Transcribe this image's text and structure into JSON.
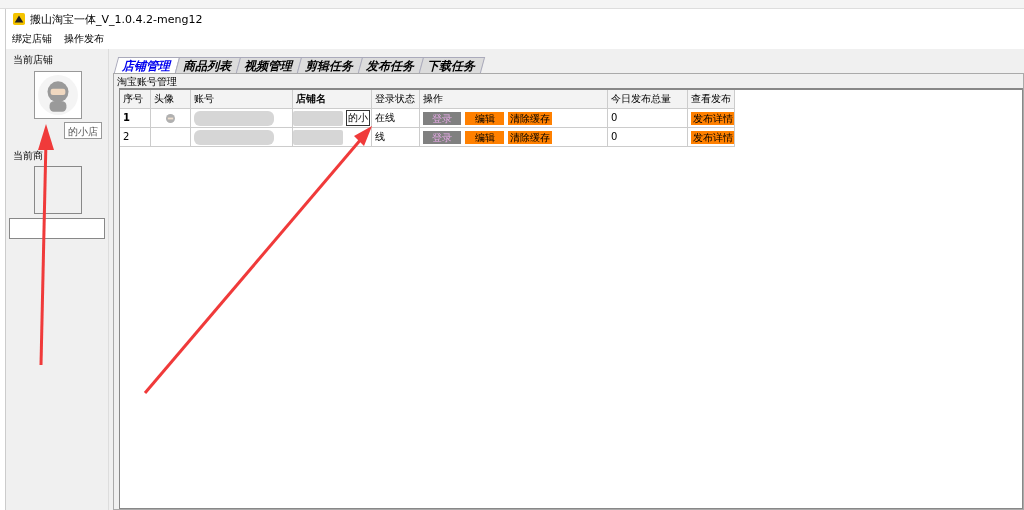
{
  "window": {
    "title": "搬山淘宝一体_V_1.0.4.2-meng12"
  },
  "menu": [
    "绑定店铺",
    "操作发布"
  ],
  "sidebar": {
    "store_label": "当前店铺",
    "store_name": "的小店",
    "product_label": "当前商"
  },
  "tabs": [
    {
      "label": "店铺管理",
      "selected": true
    },
    {
      "label": "商品列表",
      "selected": false
    },
    {
      "label": "视频管理",
      "selected": false
    },
    {
      "label": "剪辑任务",
      "selected": false
    },
    {
      "label": "发布任务",
      "selected": false
    },
    {
      "label": "下载任务",
      "selected": false
    }
  ],
  "group_title": "淘宝账号管理",
  "table": {
    "columns": [
      {
        "label": "序号",
        "bold": false
      },
      {
        "label": "头像",
        "bold": false
      },
      {
        "label": "账号",
        "bold": false
      },
      {
        "label": "店铺名",
        "bold": true
      },
      {
        "label": "登录状态",
        "bold": false
      },
      {
        "label": "操作",
        "bold": false
      },
      {
        "label": "今日发布总量",
        "bold": false
      },
      {
        "label": "查看发布",
        "bold": false
      }
    ],
    "rows": [
      {
        "index": "1",
        "current": true,
        "has_avatar": true,
        "store": "的小",
        "status": "在线",
        "actions": [
          "登录",
          "编辑",
          "清除缓存"
        ],
        "today": "0",
        "view": "发布详情"
      },
      {
        "index": "2",
        "current": false,
        "has_avatar": false,
        "store": "",
        "status": "线",
        "actions": [
          "登录",
          "编辑",
          "清除缓存"
        ],
        "today": "0",
        "view": "发布详情"
      }
    ]
  }
}
